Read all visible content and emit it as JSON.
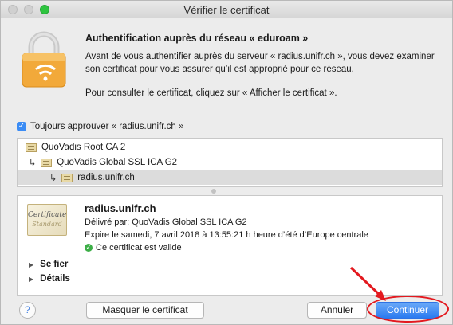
{
  "window": {
    "title": "Vérifier le certificat"
  },
  "header": {
    "heading": "Authentification auprès du réseau « eduroam »",
    "paragraph1": "Avant de vous authentifier auprès du serveur « radius.unifr.ch », vous devez examiner son certificat pour vous assurer qu’il est approprié pour ce réseau.",
    "paragraph2": "Pour consulter le certificat, cliquez sur « Afficher le certificat »."
  },
  "always_approve": {
    "label": "Toujours approuver « radius.unifr.ch »",
    "checked": true
  },
  "chain": [
    {
      "label": "QuoVadis Root CA 2",
      "indent": 0,
      "selected": false
    },
    {
      "label": "QuoVadis Global SSL ICA G2",
      "indent": 1,
      "selected": false
    },
    {
      "label": "radius.unifr.ch",
      "indent": 2,
      "selected": true
    }
  ],
  "details": {
    "badge_line1": "Certificate",
    "badge_line2": "Standard",
    "common_name": "radius.unifr.ch",
    "issuer": "Délivré par: QuoVadis Global SSL ICA G2",
    "expires": "Expire le samedi, 7 avril 2018 à 13:55:21 h heure d’été d’Europe centrale",
    "validity": "Ce certificat est valide",
    "trust_label": "Se fier",
    "details_label": "Détails"
  },
  "buttons": {
    "help": "?",
    "show_certificate": "Masquer le certificat",
    "cancel": "Annuler",
    "continue": "Continuer"
  },
  "colors": {
    "accent": "#2b7bf0",
    "annotation": "#e3191f",
    "valid": "#3cae47"
  }
}
